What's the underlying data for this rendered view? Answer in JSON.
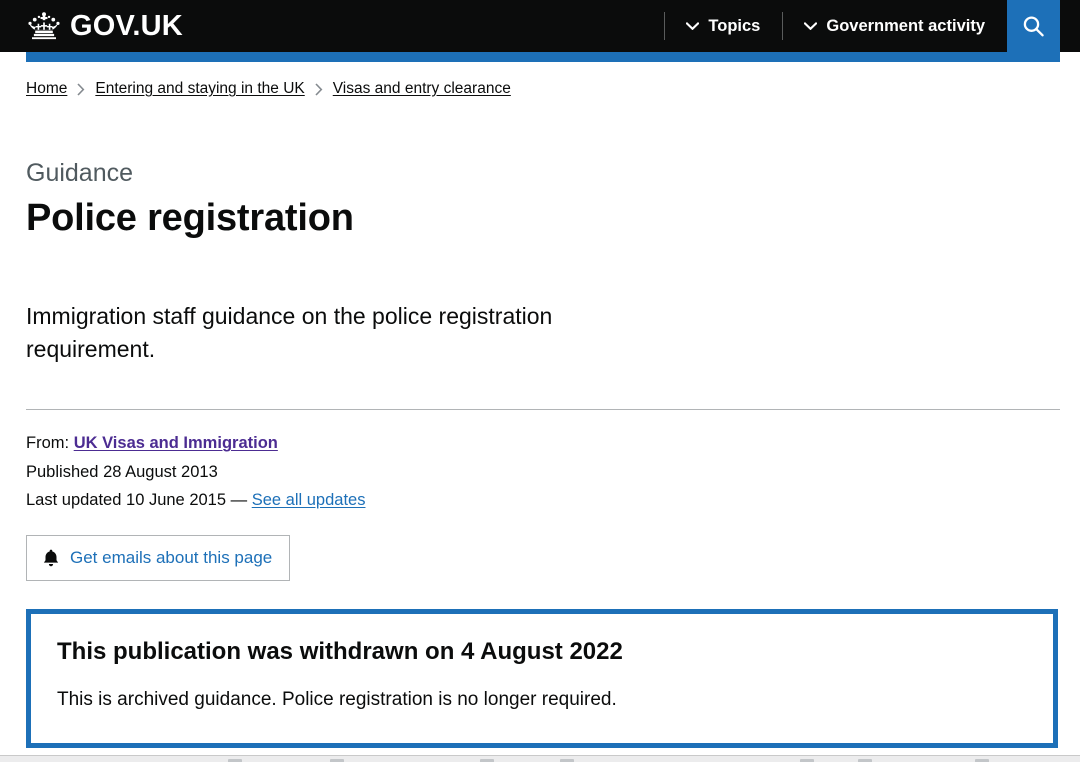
{
  "header": {
    "brand": "GOV.UK",
    "crown_icon": "crown-icon",
    "nav": [
      {
        "label": "Topics",
        "icon": "chevron-down-icon"
      },
      {
        "label": "Government activity",
        "icon": "chevron-down-icon"
      }
    ],
    "search_icon": "search-icon",
    "colors": {
      "background": "#0b0c0c",
      "accent_blue": "#1d70b8",
      "text": "#ffffff"
    }
  },
  "breadcrumb": {
    "separator": "›",
    "items": [
      {
        "label": "Home"
      },
      {
        "label": "Entering and staying in the UK"
      },
      {
        "label": "Visas and entry clearance"
      }
    ]
  },
  "main": {
    "document_type": "Guidance",
    "title": "Police registration",
    "lead": "Immigration staff guidance on the police registration requirement.",
    "metadata": {
      "from_label": "From:",
      "from_organisation": "UK Visas and Immigration",
      "published_label": "Published",
      "published_date": "28 August 2013",
      "last_updated_label": "Last updated",
      "last_updated_date": "10 June 2015",
      "dash": "—",
      "see_all_updates": "See all updates"
    },
    "email_button": {
      "label": "Get emails about this page",
      "icon": "bell-icon"
    },
    "withdrawn_notice": {
      "title": "This publication was withdrawn on 4 August 2022",
      "body": "This is archived guidance. Police registration is no longer required.",
      "border_color": "#1d70b8"
    }
  }
}
